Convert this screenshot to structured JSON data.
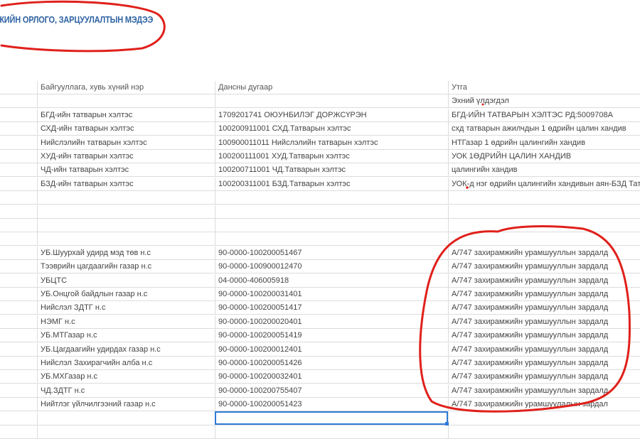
{
  "title": "ЖИЙН ОРЛОГО, ЗАРЦУУЛАЛТЫН МЭДЭЭ",
  "headers": [
    "",
    "Байгууллага, хувь хүний нэр",
    "Дансны дугаар",
    "Утга"
  ],
  "rows": [
    [
      "",
      "",
      "",
      "Эхний үлдэгдэл"
    ],
    [
      "",
      "БГД-ийн татварын хэлтэс",
      "1709201741 ОЮУНБИЛЭГ ДОРЖСҮРЭН",
      "БГД-ИЙН ТАТВАРЫН ХЭЛТЭС РД:5009708А"
    ],
    [
      "",
      "СХД-ийн татварын хэлтэс",
      "100200911001 СХД.Татварын хэлтэс",
      "схд татварын ажилчдын 1 өдрийн цалин хандив"
    ],
    [
      "",
      "Нийслэлийн татварын хэлтэс",
      "100900011011 Нийслэлийн татварын хэлтэс",
      "НТГазар 1 өдрийн цалингийн хандив"
    ],
    [
      "",
      "ХУД-ийн татварын хэлтэс",
      "100200111001 ХУД.Татварын хэлтэс",
      "УОК 1ӨДРИЙН ЦАЛИН ХАНДИВ"
    ],
    [
      "",
      "ЧД-ийн татварын хэлтэс",
      "100200711001 ЧД.Татварын хэлтэс",
      "цалингийн хандив"
    ],
    [
      "",
      "БЗД-ийн татварын хэлтэс",
      "100200311001 БЗД.Татварын хэлтэс",
      "УОК-д нэг өдрийн цалингийн хандивын аян-БЗД Татварын хэ"
    ],
    [
      "",
      "",
      "",
      ""
    ],
    [
      "",
      "",
      "",
      ""
    ],
    [
      "",
      "",
      "",
      ""
    ],
    [
      "",
      "",
      "",
      ""
    ],
    [
      "",
      "УБ.Шуурхай удирд мэд төв н.с",
      "90-0000-100200051467",
      "А/747 захирамжийн урамшууллын зардалд"
    ],
    [
      "",
      "Тээврийн цагдаагийн газар н.с",
      "90-0000-100900012470",
      "А/747 захирамжийн урамшууллын зардалд"
    ],
    [
      "",
      "УБЦТС",
      "04-0000-406005918",
      "А/747 захирамжийн урамшууллын зардалд"
    ],
    [
      "",
      "УБ.Онцгой байдлын газар н.с",
      "90-0000-100200031401",
      "А/747 захирамжийн урамшууллын зардалд"
    ],
    [
      "",
      "Нийслэл ЗДТГ н.с",
      "90-0000-100200051417",
      "А/747 захирамжийн урамшууллын зардалд"
    ],
    [
      "",
      "НЭМГ н.с",
      "90-0000-100200020401",
      "А/747 захирамжийн урамшууллын зардалд"
    ],
    [
      "",
      "УБ.МТГазар н.с",
      "90-0000-100200051419",
      "А/747 захирамжийн урамшууллын зардалд"
    ],
    [
      "",
      "УБ.Цагдаагийн удирдах газар н.с",
      "90-0000-100200012401",
      "А/747 захирамжийн урамшууллын зардалд"
    ],
    [
      "",
      "Нийслэл Захирагчийн алба н.с",
      "90-0000-100200051426",
      "А/747 захирамжийн урамшууллын зардалд"
    ],
    [
      "",
      "УБ.МХГазар н.с",
      "90-0000-100200032401",
      "А/747 захирамжийн урамшууллын зардалд"
    ],
    [
      "",
      "ЧД.ЗДТГ н.с",
      "90-0000-100200755407",
      "А/747 захирамжийн урамшууллын зардалд"
    ],
    [
      "",
      "Нийтлэг үйлчилгээний газар н.с",
      "90-0000-100200051423",
      "А/747 захирамжийн урамшуулалын зардал"
    ],
    [
      "",
      "",
      "",
      ""
    ],
    [
      "",
      "",
      "",
      ""
    ]
  ],
  "annotation_color": "#e0201b",
  "selection_color": "#2f7bd6"
}
